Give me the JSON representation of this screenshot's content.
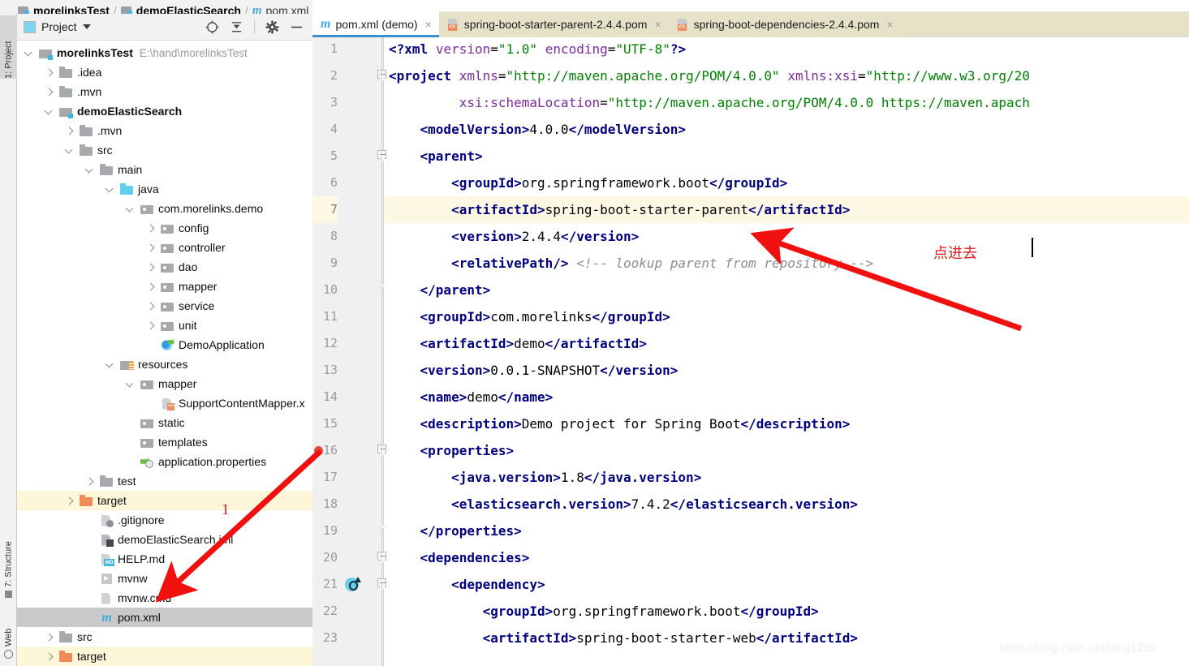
{
  "breadcrumb": {
    "items": [
      {
        "label": "morelinksTest",
        "icon": "module-folder-icon"
      },
      {
        "label": "demoElasticSearch",
        "icon": "module-folder-icon"
      },
      {
        "label": "pom.xml",
        "icon": "maven-m-icon"
      }
    ],
    "separator": "/"
  },
  "tool_strip": {
    "project_label": "1: Project",
    "structure_label": "7: Structure",
    "web_label": "Web"
  },
  "project_panel": {
    "title": "Project",
    "actions": [
      {
        "name": "locate-icon",
        "tooltip": "Select Opened File"
      },
      {
        "name": "collapse-all-icon",
        "tooltip": "Collapse All"
      },
      {
        "name": "gear-icon",
        "tooltip": "Settings"
      },
      {
        "name": "minimize-icon",
        "tooltip": "Hide"
      }
    ],
    "tree": [
      {
        "indent": 0,
        "arrow": "open",
        "icon": "module-folder-icon",
        "label": "morelinksTest",
        "bold": true,
        "path": "E:\\hand\\morelinksTest",
        "state": "normal"
      },
      {
        "indent": 1,
        "arrow": "closed",
        "icon": "folder-icon",
        "label": ".idea",
        "bold": false,
        "path": "",
        "state": "normal"
      },
      {
        "indent": 1,
        "arrow": "closed",
        "icon": "folder-icon",
        "label": ".mvn",
        "bold": false,
        "path": "",
        "state": "normal"
      },
      {
        "indent": 1,
        "arrow": "open",
        "icon": "module-folder-icon",
        "label": "demoElasticSearch",
        "bold": true,
        "path": "",
        "state": "normal"
      },
      {
        "indent": 2,
        "arrow": "closed",
        "icon": "folder-icon",
        "label": ".mvn",
        "bold": false,
        "path": "",
        "state": "normal"
      },
      {
        "indent": 2,
        "arrow": "open",
        "icon": "folder-icon",
        "label": "src",
        "bold": false,
        "path": "",
        "state": "normal"
      },
      {
        "indent": 3,
        "arrow": "open",
        "icon": "folder-icon",
        "label": "main",
        "bold": false,
        "path": "",
        "state": "normal"
      },
      {
        "indent": 4,
        "arrow": "open",
        "icon": "source-root-folder-icon",
        "label": "java",
        "bold": false,
        "path": "",
        "state": "normal"
      },
      {
        "indent": 5,
        "arrow": "open",
        "icon": "package-icon",
        "label": "com.morelinks.demo",
        "bold": false,
        "path": "",
        "state": "normal"
      },
      {
        "indent": 6,
        "arrow": "closed",
        "icon": "package-icon",
        "label": "config",
        "bold": false,
        "path": "",
        "state": "normal"
      },
      {
        "indent": 6,
        "arrow": "closed",
        "icon": "package-icon",
        "label": "controller",
        "bold": false,
        "path": "",
        "state": "normal"
      },
      {
        "indent": 6,
        "arrow": "closed",
        "icon": "package-icon",
        "label": "dao",
        "bold": false,
        "path": "",
        "state": "normal"
      },
      {
        "indent": 6,
        "arrow": "closed",
        "icon": "package-icon",
        "label": "mapper",
        "bold": false,
        "path": "",
        "state": "normal"
      },
      {
        "indent": 6,
        "arrow": "closed",
        "icon": "package-icon",
        "label": "service",
        "bold": false,
        "path": "",
        "state": "normal"
      },
      {
        "indent": 6,
        "arrow": "closed",
        "icon": "package-icon",
        "label": "unit",
        "bold": false,
        "path": "",
        "state": "normal"
      },
      {
        "indent": 6,
        "arrow": "none",
        "icon": "spring-boot-class-icon",
        "label": "DemoApplication",
        "bold": false,
        "path": "",
        "state": "normal"
      },
      {
        "indent": 4,
        "arrow": "open",
        "icon": "resources-root-folder-icon",
        "label": "resources",
        "bold": false,
        "path": "",
        "state": "normal"
      },
      {
        "indent": 5,
        "arrow": "open",
        "icon": "package-icon",
        "label": "mapper",
        "bold": false,
        "path": "",
        "state": "normal"
      },
      {
        "indent": 6,
        "arrow": "none",
        "icon": "xml-file-icon",
        "label": "SupportContentMapper.x",
        "bold": false,
        "path": "",
        "state": "normal"
      },
      {
        "indent": 5,
        "arrow": "none",
        "icon": "package-icon",
        "label": "static",
        "bold": false,
        "path": "",
        "state": "normal"
      },
      {
        "indent": 5,
        "arrow": "none",
        "icon": "package-icon",
        "label": "templates",
        "bold": false,
        "path": "",
        "state": "normal"
      },
      {
        "indent": 5,
        "arrow": "none",
        "icon": "properties-file-icon",
        "label": "application.properties",
        "bold": false,
        "path": "",
        "state": "normal"
      },
      {
        "indent": 3,
        "arrow": "closed",
        "icon": "folder-icon",
        "label": "test",
        "bold": false,
        "path": "",
        "state": "normal"
      },
      {
        "indent": 2,
        "arrow": "closed",
        "icon": "excluded-folder-icon",
        "label": "target",
        "bold": false,
        "path": "",
        "state": "highlight"
      },
      {
        "indent": 3,
        "arrow": "none",
        "icon": "gitignore-file-icon",
        "label": ".gitignore",
        "bold": false,
        "path": "",
        "state": "normal"
      },
      {
        "indent": 3,
        "arrow": "none",
        "icon": "iml-file-icon",
        "label": "demoElasticSearch.iml",
        "bold": false,
        "path": "",
        "state": "normal"
      },
      {
        "indent": 3,
        "arrow": "none",
        "icon": "markdown-file-icon",
        "label": "HELP.md",
        "bold": false,
        "path": "",
        "state": "normal"
      },
      {
        "indent": 3,
        "arrow": "none",
        "icon": "script-file-icon",
        "label": "mvnw",
        "bold": false,
        "path": "",
        "state": "normal"
      },
      {
        "indent": 3,
        "arrow": "none",
        "icon": "cmd-file-icon",
        "label": "mvnw.cmd",
        "bold": false,
        "path": "",
        "state": "normal"
      },
      {
        "indent": 3,
        "arrow": "none",
        "icon": "maven-pom-icon",
        "label": "pom.xml",
        "bold": false,
        "path": "",
        "state": "selected"
      },
      {
        "indent": 1,
        "arrow": "closed",
        "icon": "folder-icon",
        "label": "src",
        "bold": false,
        "path": "",
        "state": "normal"
      },
      {
        "indent": 1,
        "arrow": "closed",
        "icon": "excluded-folder-icon",
        "label": "target",
        "bold": false,
        "path": "",
        "state": "highlight"
      }
    ]
  },
  "editor": {
    "tabs": [
      {
        "label": "pom.xml (demo)",
        "icon": "maven-m-icon",
        "active": true,
        "close": "×"
      },
      {
        "label": "spring-boot-starter-parent-2.4.4.pom",
        "icon": "xml-file-icon",
        "active": false,
        "close": "×"
      },
      {
        "label": "spring-boot-dependencies-2.4.4.pom",
        "icon": "xml-file-icon",
        "active": false,
        "close": "×"
      }
    ],
    "current_line": 7,
    "lines": [
      {
        "n": 1,
        "fold": "none",
        "marker": "none",
        "indent": 0,
        "tokens": [
          {
            "t": "pi",
            "v": "<?xml"
          },
          {
            "t": "sp",
            "v": " "
          },
          {
            "t": "attr",
            "v": "version"
          },
          {
            "t": "punct",
            "v": "="
          },
          {
            "t": "str",
            "v": "\"1.0\""
          },
          {
            "t": "sp",
            "v": " "
          },
          {
            "t": "attr",
            "v": "encoding"
          },
          {
            "t": "punct",
            "v": "="
          },
          {
            "t": "str",
            "v": "\"UTF-8\""
          },
          {
            "t": "pi",
            "v": "?>"
          }
        ]
      },
      {
        "n": 2,
        "fold": "start",
        "marker": "none",
        "indent": 0,
        "tokens": [
          {
            "t": "tag",
            "v": "<project"
          },
          {
            "t": "sp",
            "v": " "
          },
          {
            "t": "attr",
            "v": "xmlns"
          },
          {
            "t": "punct",
            "v": "="
          },
          {
            "t": "str",
            "v": "\"http://maven.apache.org/POM/4.0.0\""
          },
          {
            "t": "sp",
            "v": " "
          },
          {
            "t": "attr",
            "v": "xmlns:xsi"
          },
          {
            "t": "punct",
            "v": "="
          },
          {
            "t": "str",
            "v": "\"http://www.w3.org/20"
          }
        ]
      },
      {
        "n": 3,
        "fold": "none",
        "marker": "none",
        "indent": 0,
        "tokens": [
          {
            "t": "sp",
            "v": "         "
          },
          {
            "t": "attr",
            "v": "xsi:schemaLocation"
          },
          {
            "t": "punct",
            "v": "="
          },
          {
            "t": "str",
            "v": "\"http://maven.apache.org/POM/4.0.0 https://maven.apach"
          }
        ]
      },
      {
        "n": 4,
        "fold": "none",
        "marker": "none",
        "indent": 0,
        "tokens": [
          {
            "t": "sp",
            "v": "    "
          },
          {
            "t": "tag",
            "v": "<modelVersion>"
          },
          {
            "t": "txt",
            "v": "4.0.0"
          },
          {
            "t": "tag",
            "v": "</modelVersion>"
          }
        ]
      },
      {
        "n": 5,
        "fold": "start",
        "marker": "none",
        "indent": 0,
        "tokens": [
          {
            "t": "sp",
            "v": "    "
          },
          {
            "t": "tag",
            "v": "<parent>"
          }
        ]
      },
      {
        "n": 6,
        "fold": "none",
        "marker": "none",
        "indent": 0,
        "tokens": [
          {
            "t": "sp",
            "v": "        "
          },
          {
            "t": "tag",
            "v": "<groupId>"
          },
          {
            "t": "txt",
            "v": "org.springframework.boot"
          },
          {
            "t": "tag",
            "v": "</groupId>"
          }
        ]
      },
      {
        "n": 7,
        "fold": "none",
        "marker": "bulb",
        "indent": 0,
        "tokens": [
          {
            "t": "sp",
            "v": "        "
          },
          {
            "t": "tag",
            "v": "<artifactId>"
          },
          {
            "t": "txt",
            "v": "spring-boot-starter-parent"
          },
          {
            "t": "tag",
            "v": "</artifactId>"
          }
        ]
      },
      {
        "n": 8,
        "fold": "none",
        "marker": "none",
        "indent": 0,
        "tokens": [
          {
            "t": "sp",
            "v": "        "
          },
          {
            "t": "tag",
            "v": "<version>"
          },
          {
            "t": "txt",
            "v": "2.4.4"
          },
          {
            "t": "tag",
            "v": "</version>"
          }
        ]
      },
      {
        "n": 9,
        "fold": "none",
        "marker": "none",
        "indent": 0,
        "tokens": [
          {
            "t": "sp",
            "v": "        "
          },
          {
            "t": "tag",
            "v": "<relativePath/>"
          },
          {
            "t": "sp",
            "v": " "
          },
          {
            "t": "cmt",
            "v": "<!-- lookup parent from repository -->"
          }
        ]
      },
      {
        "n": 10,
        "fold": "end",
        "marker": "none",
        "indent": 0,
        "tokens": [
          {
            "t": "sp",
            "v": "    "
          },
          {
            "t": "tag",
            "v": "</parent>"
          }
        ]
      },
      {
        "n": 11,
        "fold": "none",
        "marker": "none",
        "indent": 0,
        "tokens": [
          {
            "t": "sp",
            "v": "    "
          },
          {
            "t": "tag",
            "v": "<groupId>"
          },
          {
            "t": "txt",
            "v": "com.morelinks"
          },
          {
            "t": "tag",
            "v": "</groupId>"
          }
        ]
      },
      {
        "n": 12,
        "fold": "none",
        "marker": "none",
        "indent": 0,
        "tokens": [
          {
            "t": "sp",
            "v": "    "
          },
          {
            "t": "tag",
            "v": "<artifactId>"
          },
          {
            "t": "txt",
            "v": "demo"
          },
          {
            "t": "tag",
            "v": "</artifactId>"
          }
        ]
      },
      {
        "n": 13,
        "fold": "none",
        "marker": "none",
        "indent": 0,
        "tokens": [
          {
            "t": "sp",
            "v": "    "
          },
          {
            "t": "tag",
            "v": "<version>"
          },
          {
            "t": "txt",
            "v": "0.0.1-SNAPSHOT"
          },
          {
            "t": "tag",
            "v": "</version>"
          }
        ]
      },
      {
        "n": 14,
        "fold": "none",
        "marker": "none",
        "indent": 0,
        "tokens": [
          {
            "t": "sp",
            "v": "    "
          },
          {
            "t": "tag",
            "v": "<name>"
          },
          {
            "t": "txt",
            "v": "demo"
          },
          {
            "t": "tag",
            "v": "</name>"
          }
        ]
      },
      {
        "n": 15,
        "fold": "none",
        "marker": "none",
        "indent": 0,
        "tokens": [
          {
            "t": "sp",
            "v": "    "
          },
          {
            "t": "tag",
            "v": "<description>"
          },
          {
            "t": "txt",
            "v": "Demo project for Spring Boot"
          },
          {
            "t": "tag",
            "v": "</description>"
          }
        ]
      },
      {
        "n": 16,
        "fold": "start",
        "marker": "breakpoint",
        "indent": 0,
        "tokens": [
          {
            "t": "sp",
            "v": "    "
          },
          {
            "t": "tag",
            "v": "<properties>"
          }
        ]
      },
      {
        "n": 17,
        "fold": "none",
        "marker": "none",
        "indent": 0,
        "tokens": [
          {
            "t": "sp",
            "v": "        "
          },
          {
            "t": "tag",
            "v": "<java.version>"
          },
          {
            "t": "txt",
            "v": "1.8"
          },
          {
            "t": "tag",
            "v": "</java.version>"
          }
        ]
      },
      {
        "n": 18,
        "fold": "none",
        "marker": "none",
        "indent": 0,
        "tokens": [
          {
            "t": "sp",
            "v": "        "
          },
          {
            "t": "tag",
            "v": "<elasticsearch.version>"
          },
          {
            "t": "txt",
            "v": "7.4.2"
          },
          {
            "t": "tag",
            "v": "</elasticsearch.version>"
          }
        ]
      },
      {
        "n": 19,
        "fold": "end",
        "marker": "none",
        "indent": 0,
        "tokens": [
          {
            "t": "sp",
            "v": "    "
          },
          {
            "t": "tag",
            "v": "</properties>"
          }
        ]
      },
      {
        "n": 20,
        "fold": "start",
        "marker": "none",
        "indent": 0,
        "tokens": [
          {
            "t": "sp",
            "v": "    "
          },
          {
            "t": "tag",
            "v": "<dependencies>"
          }
        ]
      },
      {
        "n": 21,
        "fold": "start",
        "marker": "override",
        "indent": 0,
        "tokens": [
          {
            "t": "sp",
            "v": "        "
          },
          {
            "t": "tag",
            "v": "<dependency>"
          }
        ]
      },
      {
        "n": 22,
        "fold": "none",
        "marker": "none",
        "indent": 0,
        "tokens": [
          {
            "t": "sp",
            "v": "            "
          },
          {
            "t": "tag",
            "v": "<groupId>"
          },
          {
            "t": "txt",
            "v": "org.springframework.boot"
          },
          {
            "t": "tag",
            "v": "</groupId>"
          }
        ]
      },
      {
        "n": 23,
        "fold": "none",
        "marker": "none",
        "indent": 0,
        "tokens": [
          {
            "t": "sp",
            "v": "            "
          },
          {
            "t": "tag",
            "v": "<artifactId>"
          },
          {
            "t": "txt",
            "v": "spring-boot-starter-web"
          },
          {
            "t": "tag",
            "v": "</artifactId>"
          }
        ]
      }
    ]
  },
  "annotations": {
    "arrow_1_label": "1",
    "arrow_2_label": "点进去",
    "color": "#f01010"
  },
  "watermark": "https://blog.csdn.net/long1250"
}
